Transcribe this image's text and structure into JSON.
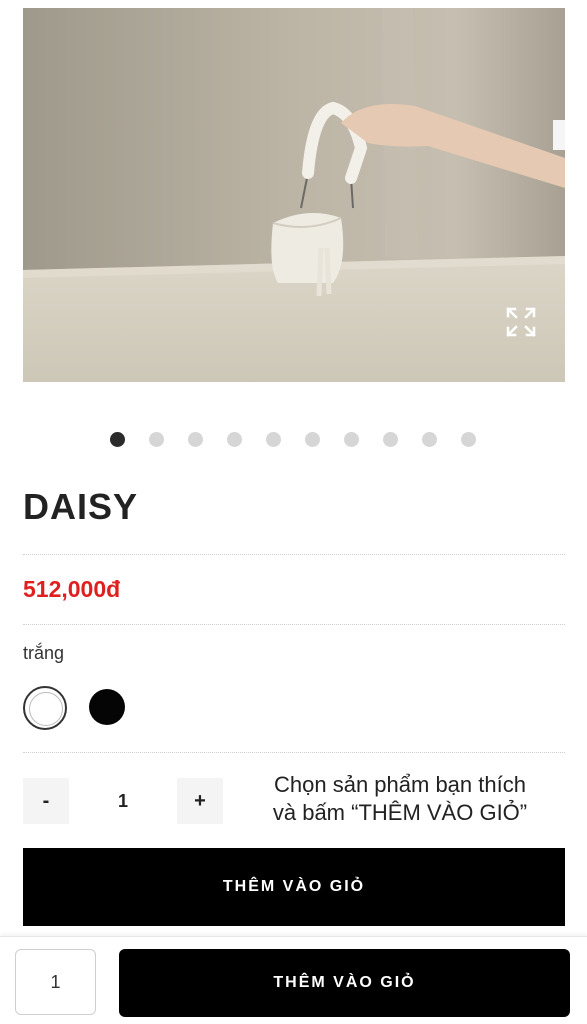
{
  "product": {
    "image_icon": "product-photo",
    "expand_icon": "expand-icon",
    "slide_count": 10,
    "active_slide": 0,
    "name": "DAISY",
    "price": "512,000đ",
    "color_label": "trắng",
    "colors": [
      {
        "name": "white",
        "hex": "#ffffff",
        "selected": true
      },
      {
        "name": "black",
        "hex": "#050505",
        "selected": false
      }
    ]
  },
  "quantity": {
    "minus": "-",
    "value": "1",
    "plus": "+"
  },
  "hint": {
    "line1": "Chọn sản phẩm bạn thích",
    "line2": "và bấm “THÊM VÀO GIỎ”"
  },
  "add_to_cart": "THÊM VÀO GIỎ",
  "sticky": {
    "quantity": "1",
    "button": "THÊM VÀO GIỎ"
  }
}
